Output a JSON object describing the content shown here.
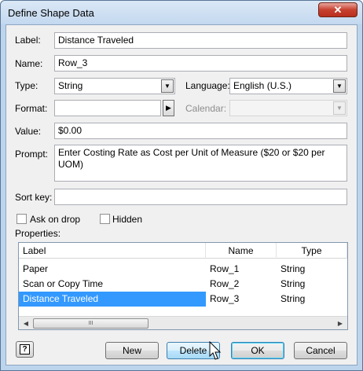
{
  "window": {
    "title": "Define Shape Data",
    "close_glyph": "✕"
  },
  "form": {
    "label_caption": "Label:",
    "label_value": "Distance Traveled",
    "name_caption": "Name:",
    "name_value": "Row_3",
    "type_caption": "Type:",
    "type_value": "String",
    "language_caption": "Language:",
    "language_value": "English (U.S.)",
    "format_caption": "Format:",
    "format_value": "",
    "calendar_caption": "Calendar:",
    "calendar_value": "",
    "value_caption": "Value:",
    "value_value": "$0.00",
    "prompt_caption": "Prompt:",
    "prompt_value": "Enter Costing Rate as Cost per Unit of Measure ($20 or $20 per UOM)",
    "sortkey_caption": "Sort key:",
    "sortkey_value": "",
    "ask_on_drop_label": "Ask on drop",
    "ask_on_drop_checked": false,
    "hidden_label": "Hidden",
    "hidden_checked": false,
    "properties_caption": "Properties:"
  },
  "properties": {
    "columns": [
      "Label",
      "Name",
      "Type"
    ],
    "rows": [
      {
        "label": "Paper",
        "name": "Row_1",
        "type": "String",
        "selected": false
      },
      {
        "label": "Scan or Copy Time",
        "name": "Row_2",
        "type": "String",
        "selected": false
      },
      {
        "label": "Distance Traveled",
        "name": "Row_3",
        "type": "String",
        "selected": true
      }
    ],
    "scroll_grip": "III"
  },
  "buttons": {
    "new": "New",
    "delete": "Delete",
    "ok": "OK",
    "cancel": "Cancel",
    "help_glyph": "?"
  },
  "colors": {
    "selection": "#3399ff",
    "title_bar": "#c3d8ef",
    "close_button": "#c7412f"
  },
  "icons": {
    "help": "help-icon",
    "format_picker": "play-arrow-icon",
    "dropdown": "chevron-down-icon"
  }
}
